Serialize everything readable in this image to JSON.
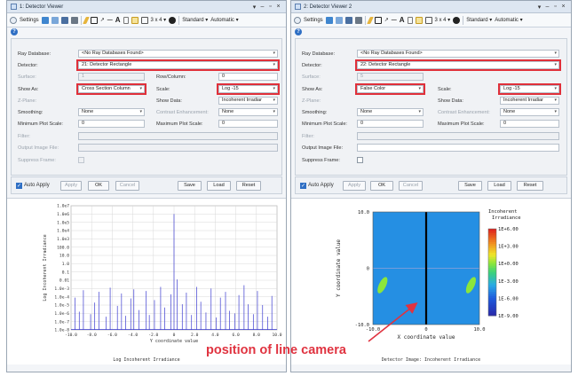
{
  "windows": [
    {
      "title": "1: Detector Viewer",
      "toolbar": {
        "settings_label": "Settings",
        "layout_label": "3 x 4 ▾",
        "standard_label": "Standard ▾",
        "automatic_label": "Automatic ▾"
      },
      "form": {
        "ray_database_label": "Ray Database:",
        "ray_database_value": "<No Ray Databases Found>",
        "detector_label": "Detector:",
        "detector_value": "21: Detector Rectangle",
        "surface_label": "Surface:",
        "surface_value": "1",
        "row_column_label": "Row/Column:",
        "row_column_value": "0",
        "show_as_label": "Show As:",
        "show_as_value": "Cross Section Column",
        "scale_label": "Scale:",
        "scale_value": "Log -15",
        "z_plane_label": "Z-Plane:",
        "show_data_label": "Show Data:",
        "show_data_value": "Incoherent Irradiar",
        "smoothing_label": "Smoothing:",
        "smoothing_value": "None",
        "contrast_label": "Contrast Enhancement:",
        "contrast_value": "None",
        "min_plot_scale_label": "Minimum Plot Scale:",
        "min_plot_scale_value": "0",
        "max_plot_scale_label": "Maximum Plot Scale:",
        "max_plot_scale_value": "0",
        "filter_label": "Filter:",
        "output_image_label": "Output Image File:",
        "suppress_frame_label": "Suppress Frame:"
      },
      "buttons": {
        "auto_apply": "Auto Apply",
        "apply": "Apply",
        "ok": "OK",
        "cancel": "Cancel",
        "save": "Save",
        "load": "Load",
        "reset": "Reset"
      },
      "caption": "Log Incoherent Irradiance"
    },
    {
      "title": "2: Detector Viewer 2",
      "toolbar": {
        "settings_label": "Settings",
        "layout_label": "3 x 4 ▾",
        "standard_label": "Standard ▾",
        "automatic_label": "Automatic ▾"
      },
      "form": {
        "ray_database_label": "Ray Database:",
        "ray_database_value": "<No Ray Databases Found>",
        "detector_label": "Detector:",
        "detector_value": "22: Detector Rectangle",
        "surface_label": "Surface:",
        "surface_value": "5",
        "show_as_label": "Show As:",
        "show_as_value": "False Color",
        "scale_label": "Scale:",
        "scale_value": "Log -15",
        "z_plane_label": "Z-Plane:",
        "show_data_label": "Show Data:",
        "show_data_value": "Incoherent Irradiar",
        "smoothing_label": "Smoothing:",
        "smoothing_value": "None",
        "contrast_label": "Contrast Enhancement:",
        "contrast_value": "None",
        "min_plot_scale_label": "Minimum Plot Scale:",
        "min_plot_scale_value": "0",
        "max_plot_scale_label": "Maximum Plot Scale:",
        "max_plot_scale_value": "0",
        "filter_label": "Filter:",
        "output_image_label": "Output Image File:",
        "suppress_frame_label": "Suppress Frame:"
      },
      "buttons": {
        "auto_apply": "Auto Apply",
        "apply": "Apply",
        "ok": "OK",
        "cancel": "Cancel",
        "save": "Save",
        "load": "Load",
        "reset": "Reset"
      },
      "caption": "Detector Image: Incoherent Irradiance"
    }
  ],
  "annotation": "position of line camera",
  "colors": {
    "highlight": "#e0303a",
    "annotation": "#e03340",
    "plot_line": "#3b3bd0"
  },
  "chart_data": [
    {
      "type": "line",
      "title": "",
      "xlabel": "Y coordinate value",
      "ylabel": "Log Incoherent Irradiance",
      "x_ticks": [
        "-10.0",
        "-8.0",
        "-6.0",
        "-4.0",
        "-2.0",
        "0",
        "2.0",
        "4.0",
        "6.0",
        "8.0",
        "10.0"
      ],
      "y_ticks": [
        "1.0e7",
        "1.0e6",
        "1.0e5",
        "1.0e4",
        "1.0e3",
        "100.0",
        "10.0",
        "1.0",
        "0.1",
        "0.01",
        "1.0e-3",
        "1.0e-4",
        "1.0e-5",
        "1.0e-6",
        "1.0e-7",
        "1.0e-8"
      ],
      "xlim": [
        -10,
        10
      ],
      "ylim_log10": [
        -8,
        7
      ],
      "grid": true,
      "series": [
        {
          "x": [
            -9.6,
            -9.2,
            -8.8,
            -8.1,
            -7.7,
            -7.3,
            -6.6,
            -6.2,
            -5.5,
            -5.1,
            -4.7,
            -4.2,
            -3.9,
            -3.4,
            -2.7,
            -2.4,
            -1.9,
            -1.3,
            -0.9,
            -0.3,
            0.0,
            0.3,
            0.8,
            1.2,
            1.7,
            2.2,
            2.6,
            3.1,
            3.6,
            4.1,
            4.5,
            5.0,
            5.4,
            5.9,
            6.3,
            6.8,
            7.2,
            7.7,
            8.1,
            8.6,
            9.1,
            9.5
          ],
          "log10_y": [
            -4.1,
            -5.8,
            -3.2,
            -6.1,
            -4.7,
            -3.4,
            -6.4,
            -2.9,
            -5.1,
            -3.6,
            -6.3,
            -4.2,
            -3.1,
            -5.6,
            -3.3,
            -6.2,
            -4.4,
            -2.8,
            -5.3,
            -3.7,
            6.0,
            -1.9,
            -4.9,
            -3.5,
            -6.2,
            -2.8,
            -4.6,
            -5.9,
            -3.0,
            -6.5,
            -4.1,
            -3.4,
            -5.7,
            -6.0,
            -3.8,
            -2.6,
            -4.9,
            -6.1,
            -3.3,
            -5.0,
            -6.4,
            -3.9
          ]
        }
      ]
    },
    {
      "type": "heatmap",
      "title": "",
      "xlabel": "X coordinate value",
      "ylabel": "Y coordinate value",
      "x_ticks": [
        "-10.0",
        "0",
        "10.0"
      ],
      "y_ticks": [
        "10.0",
        "0",
        "-10.0"
      ],
      "xlim": [
        -10,
        10
      ],
      "ylim": [
        -10,
        10
      ],
      "colorbar_title": "Incoherent Irradiance",
      "colorbar_ticks": [
        "1E+6.00",
        "1E+3.00",
        "1E+0.00",
        "1E-3.00",
        "1E-6.00",
        "1E-9.00"
      ],
      "colorbar_range_log10": [
        -9,
        6
      ],
      "features": {
        "background_log10": -4.5,
        "vertical_line_x": 0,
        "horizontal_band_y": 0,
        "green_spots": [
          {
            "x": -8.2,
            "y": -3.0,
            "log10": 0
          },
          {
            "x": 8.4,
            "y": -3.0,
            "log10": 0
          }
        ]
      }
    }
  ]
}
